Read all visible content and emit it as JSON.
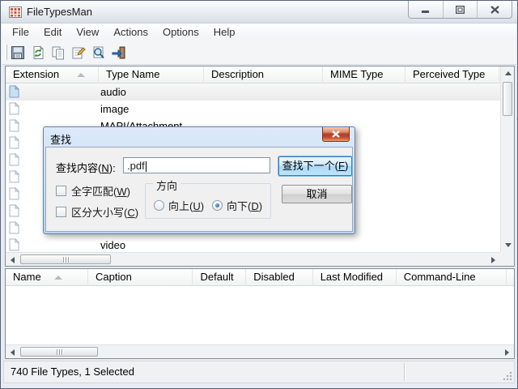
{
  "window": {
    "title": "FileTypesMan"
  },
  "colors": {
    "dialog_frame_blue": "#bdd4ec",
    "close_button_red": "#b23a24",
    "default_button_focus": "#3c7fb1",
    "selected_row_bg": "#ededed"
  },
  "menu": {
    "items": [
      "File",
      "Edit",
      "View",
      "Actions",
      "Options",
      "Help"
    ]
  },
  "toolbar": {
    "icons": [
      "save-icon",
      "refresh-icon",
      "copy-icon",
      "properties-icon",
      "find-icon",
      "exit-icon"
    ]
  },
  "file_list": {
    "columns": [
      "Extension",
      "Type Name",
      "Description",
      "MIME Type",
      "Perceived Type"
    ],
    "sorted_column": "Extension",
    "rows": [
      {
        "type_name": "audio",
        "selected": true
      },
      {
        "type_name": "image"
      },
      {
        "type_name": "MAPI/Attachment"
      },
      {
        "type_name": ""
      },
      {
        "type_name": ""
      },
      {
        "type_name": ""
      },
      {
        "type_name": ""
      },
      {
        "type_name": ""
      },
      {
        "type_name": ""
      },
      {
        "type_name": "video"
      }
    ]
  },
  "find_dialog": {
    "title": "查找",
    "find_label": {
      "pre": "查找内容(",
      "key": "N",
      "post": "):"
    },
    "input_value": ".pdf",
    "find_next_button": {
      "pre": "查找下一个(",
      "key": "F",
      "post": ")"
    },
    "cancel_button": "取消",
    "whole_word_checkbox": {
      "pre": "全字匹配(",
      "key": "W",
      "post": ")",
      "checked": false
    },
    "match_case_checkbox": {
      "pre": "区分大小写(",
      "key": "C",
      "post": ")",
      "checked": false
    },
    "direction_group": {
      "label": "方向",
      "up_radio": {
        "pre": "向上(",
        "key": "U",
        "post": ")",
        "selected": false
      },
      "down_radio": {
        "pre": "向下(",
        "key": "D",
        "post": ")",
        "selected": true
      }
    }
  },
  "actions_list": {
    "columns": [
      "Name",
      "Caption",
      "Default",
      "Disabled",
      "Last Modified",
      "Command-Line"
    ],
    "sorted_column": "Name",
    "rows": []
  },
  "status_bar": {
    "text": "740 File Types, 1 Selected"
  }
}
